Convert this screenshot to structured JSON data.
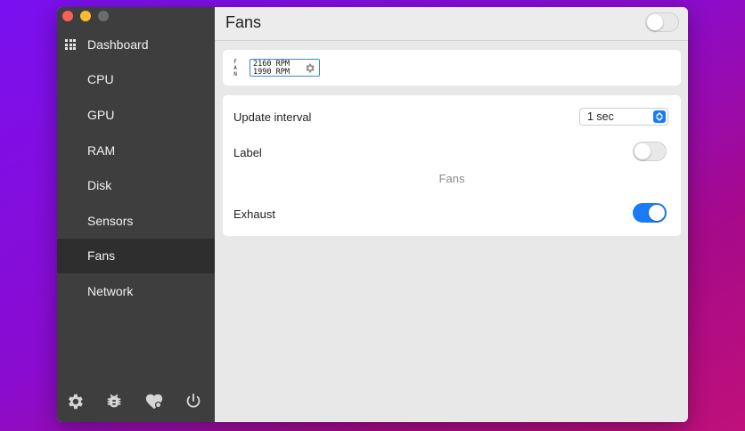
{
  "window": {
    "traffic_lights": {
      "close": "#fd5e57",
      "minimize": "#fdbb2f",
      "zoom": "#6b6b6b"
    }
  },
  "sidebar": {
    "items": [
      {
        "label": "Dashboard",
        "icon": "grid-icon"
      },
      {
        "label": "CPU"
      },
      {
        "label": "GPU"
      },
      {
        "label": "RAM"
      },
      {
        "label": "Disk"
      },
      {
        "label": "Sensors"
      },
      {
        "label": "Fans",
        "active": true
      },
      {
        "label": "Network"
      }
    ],
    "footer_icons": [
      "gear-icon",
      "bug-icon",
      "heart-icon",
      "power-icon"
    ]
  },
  "header": {
    "title": "Fans",
    "module_enabled": false
  },
  "preview": {
    "letters": [
      "F",
      "A",
      "N"
    ],
    "rpm_values": [
      "2160 RPM",
      "1990 RPM"
    ],
    "settings_icon": "gear-icon"
  },
  "settings": {
    "update_interval": {
      "label": "Update interval",
      "value": "1 sec"
    },
    "label_toggle": {
      "label": "Label",
      "enabled": false
    },
    "section_label": "Fans",
    "exhaust_toggle": {
      "label": "Exhaust",
      "enabled": true
    }
  },
  "colors": {
    "accent": "#1a7cf5",
    "sidebar": "#3e3e3e",
    "sidebar_active": "#2e2e2e"
  }
}
